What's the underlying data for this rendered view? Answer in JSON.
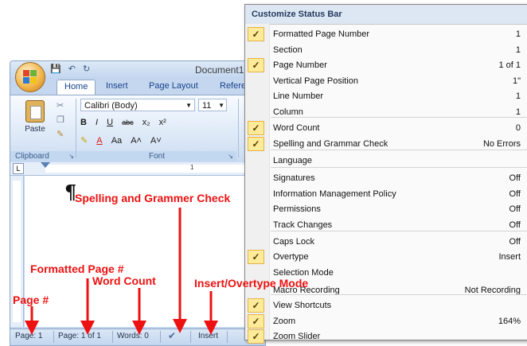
{
  "word": {
    "document_title": "Document1",
    "qat_icons": [
      "save-icon",
      "undo-icon",
      "redo-icon"
    ],
    "tabs": [
      {
        "label": "Home"
      },
      {
        "label": "Insert"
      },
      {
        "label": "Page Layout"
      },
      {
        "label": "Refere"
      }
    ],
    "ribbon": {
      "paste_label": "Paste",
      "font_name": "Calibri (Body)",
      "font_size": "11",
      "bold": "B",
      "italic": "I",
      "underline": "U",
      "strikethrough": "abc",
      "subscript": "x₂",
      "superscript": "x²",
      "change_case": "Aa",
      "grow_font": "A˄",
      "shrink_font": "A˅",
      "clipboard_group": "Clipboard",
      "font_group": "Font"
    },
    "ruler": {
      "tab_selector": "L",
      "mark_1": "1"
    },
    "page": {
      "pilcrow": "¶"
    },
    "statusbar": {
      "page": "Page: 1",
      "formatted_page": "Page: 1 of 1",
      "words": "Words: 0",
      "mode": "Insert"
    }
  },
  "menu": {
    "title": "Customize Status Bar",
    "items": [
      {
        "label": "Formatted Page Number",
        "value": "1",
        "checked": true
      },
      {
        "label": "Section",
        "value": "1",
        "checked": false
      },
      {
        "label": "Page Number",
        "value": "1 of 1",
        "checked": true
      },
      {
        "label": "Vertical Page Position",
        "value": "1\"",
        "checked": false
      },
      {
        "label": "Line Number",
        "value": "1",
        "checked": false
      },
      {
        "label": "Column",
        "value": "1",
        "checked": false
      },
      {
        "label": "Word Count",
        "value": "0",
        "checked": true
      },
      {
        "label": "Spelling and Grammar Check",
        "value": "No Errors",
        "checked": true
      },
      {
        "label": "Language",
        "value": "",
        "checked": false
      },
      {
        "label": "Signatures",
        "value": "Off",
        "checked": false
      },
      {
        "label": "Information Management Policy",
        "value": "Off",
        "checked": false
      },
      {
        "label": "Permissions",
        "value": "Off",
        "checked": false
      },
      {
        "label": "Track Changes",
        "value": "Off",
        "checked": false
      },
      {
        "label": "Caps Lock",
        "value": "Off",
        "checked": false
      },
      {
        "label": "Overtype",
        "value": "Insert",
        "checked": true
      },
      {
        "label": "Selection Mode",
        "value": "",
        "checked": false
      },
      {
        "label": "Macro Recording",
        "value": "Not Recording",
        "checked": false
      },
      {
        "label": "View Shortcuts",
        "value": "",
        "checked": true
      },
      {
        "label": "Zoom",
        "value": "164%",
        "checked": true
      },
      {
        "label": "Zoom Slider",
        "value": "",
        "checked": true
      }
    ]
  },
  "annotations": {
    "spelling": "Spelling and Grammer Check",
    "formatted_page": "Formatted Page #",
    "page": "Page #",
    "word_count": "Word Count",
    "insert_overtype": "Insert/Overtype Mode"
  },
  "colors": {
    "annotation": "#ee1111",
    "check_bg": "#fdeb9a"
  }
}
